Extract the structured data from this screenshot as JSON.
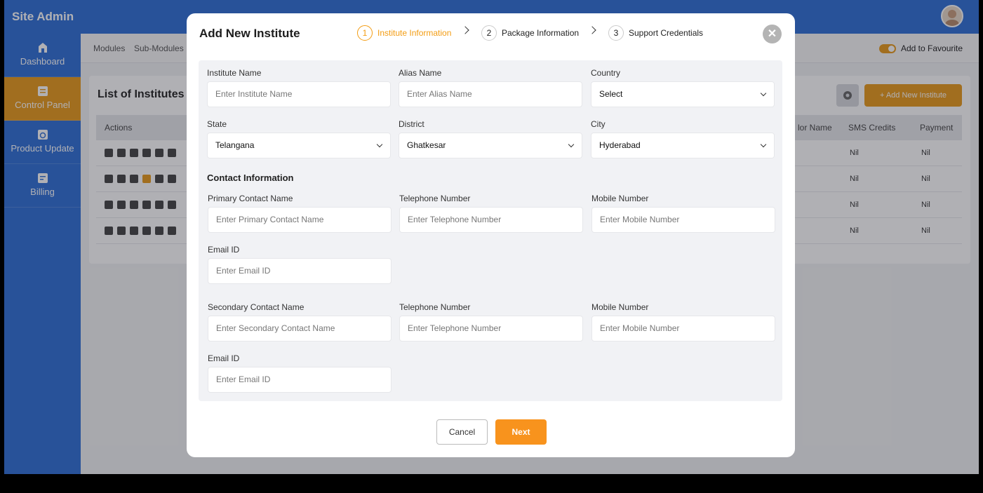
{
  "app": {
    "title": "Site Admin"
  },
  "sidebar": {
    "items": [
      {
        "label": "Dashboard",
        "icon": "school-icon"
      },
      {
        "label": "Control Panel",
        "icon": "list-icon",
        "active": true
      },
      {
        "label": "Product Update",
        "icon": "update-icon"
      },
      {
        "label": "Billing",
        "icon": "billing-icon"
      }
    ]
  },
  "breadcrumb": {
    "items": [
      "Modules",
      "Sub-Modules"
    ]
  },
  "favourite": {
    "label": "Add to Favourite",
    "enabled": true
  },
  "list": {
    "title": "List of Institutes",
    "add_label": "+ Add New Institute",
    "columns": {
      "actions": "Actions",
      "vendor": "lor Name",
      "sms": "SMS Credits",
      "payment": "Payment"
    },
    "rows": [
      {
        "sms": "Nil",
        "payment": "Nil"
      },
      {
        "sms": "Nil",
        "payment": "Nil"
      },
      {
        "sms": "Nil",
        "payment": "Nil"
      },
      {
        "sms": "Nil",
        "payment": "Nil"
      }
    ]
  },
  "modal": {
    "title": "Add New Institute",
    "steps": [
      {
        "num": "1",
        "label": "Institute Information",
        "active": true
      },
      {
        "num": "2",
        "label": "Package Information"
      },
      {
        "num": "3",
        "label": "Support Credentials"
      }
    ],
    "fields": {
      "institute_name": {
        "label": "Institute Name",
        "placeholder": "Enter Institute Name"
      },
      "alias_name": {
        "label": "Alias Name",
        "placeholder": "Enter Alias Name"
      },
      "country": {
        "label": "Country",
        "value": "Select"
      },
      "state": {
        "label": "State",
        "value": "Telangana"
      },
      "district": {
        "label": "District",
        "value": "Ghatkesar"
      },
      "city": {
        "label": "City",
        "value": "Hyderabad"
      }
    },
    "contact_section": "Contact Information",
    "primary": {
      "name": {
        "label": "Primary Contact Name",
        "placeholder": "Enter Primary Contact Name"
      },
      "telephone": {
        "label": "Telephone Number",
        "placeholder": "Enter Telephone Number"
      },
      "mobile": {
        "label": "Mobile Number",
        "placeholder": "Enter Mobile Number"
      },
      "email": {
        "label": "Email ID",
        "placeholder": "Enter Email ID"
      }
    },
    "secondary": {
      "name": {
        "label": "Secondary Contact Name",
        "placeholder": "Enter Secondary Contact Name"
      },
      "telephone": {
        "label": "Telephone Number",
        "placeholder": "Enter Telephone Number"
      },
      "mobile": {
        "label": "Mobile Number",
        "placeholder": "Enter Mobile Number"
      },
      "email": {
        "label": "Email ID",
        "placeholder": "Enter Email ID"
      }
    },
    "cancel_label": "Cancel",
    "next_label": "Next"
  },
  "colors": {
    "primary": "#2f6fd6",
    "accent": "#e99a1b",
    "next": "#f8931d"
  }
}
